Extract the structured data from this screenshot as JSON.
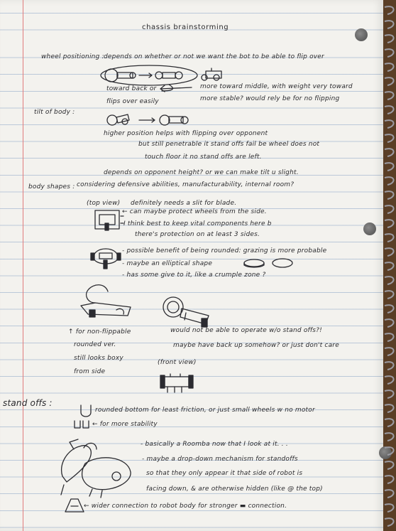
{
  "title": "chassis brainstorming",
  "wheel_positioning": {
    "heading": "wheel positioning :",
    "intro": "depends on whether or not we want the bot to be able to flip over",
    "left_1": "toward back or",
    "left_2": "flips over easily",
    "right_1": "more toward middle, with weight very toward",
    "right_2": "more stable? would rely be for no flipping"
  },
  "tilt_of_body": {
    "heading": "tilt of body :",
    "line_1": "higher position helps with flipping over opponent",
    "line_2": "but still penetrable it stand offs fail be wheel does not",
    "line_3": "touch floor it no stand offs are left.",
    "line_4": "depends on opponent height? or we can make tilt u slight."
  },
  "body_shapes": {
    "heading": "body shapes :",
    "intro": "considering defensive abilities, manufacturability, internal room?",
    "top_view": "(top view)",
    "slit": "definitely needs a slit for blade.",
    "protect": "← can maybe protect wheels from the side.",
    "vital_1": "I think best to keep vital components here b",
    "vital_2": "there's protection on at least 3 sides.",
    "rounded": "- possible benefit of being rounded: grazing is more probable",
    "elliptical": "- maybe an elliptical shape",
    "crumple": "- has some give to it, like a crumple zone ?",
    "nonflip_1": "↑ for non-flippable",
    "nonflip_2": "rounded ver.",
    "nonflip_3": "still looks boxy",
    "nonflip_4": "from side",
    "standoff_1": "would not be able to operate w/o stand offs?!",
    "standoff_2": "maybe have back up somehow? or just don't care",
    "front_view": "(front view)"
  },
  "stand_offs": {
    "heading": "stand offs :",
    "line_1": "rounded bottom for least friction, or just small wheels w no motor",
    "line_2": "← for more stability",
    "line_3": "- basically a Roomba now that I look at it. . .",
    "line_4": "- maybe a drop-down mechanism for standoffs",
    "line_5": "so that they only appear it that side of robot is",
    "line_6": "facing down, & are otherwise hidden (like @ the top)",
    "line_7": "← wider connection to robot body for stronger ▬ connection."
  }
}
